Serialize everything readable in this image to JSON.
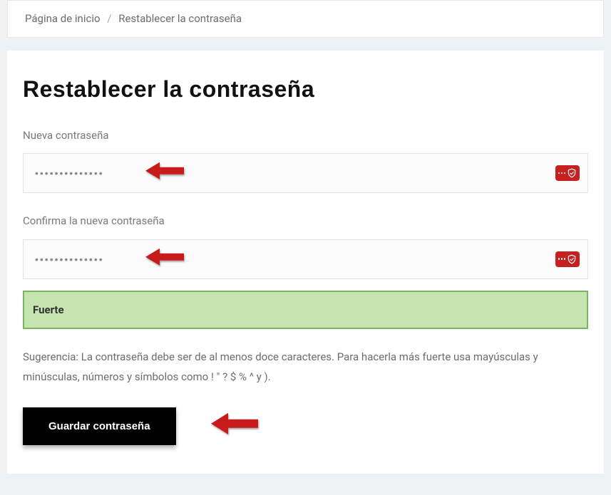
{
  "breadcrumb": {
    "home": "Página de inicio",
    "separator": "/",
    "current": "Restablecer la contraseña"
  },
  "page": {
    "title": "Restablecer la contraseña"
  },
  "form": {
    "new_password": {
      "label": "Nueva contraseña",
      "value": "••••••••••••••"
    },
    "confirm_password": {
      "label": "Confirma la nueva contraseña",
      "value": "••••••••••••••"
    },
    "strength": {
      "label": "Fuerte"
    },
    "hint": "Sugerencia: La contraseña debe ser de al menos doce caracteres. Para hacerla más fuerte usa mayúsculas y minúsculas, números y símbolos como ! \" ? $ % ^ y ).",
    "submit_label": "Guardar contraseña"
  },
  "icons": {
    "password_manager": "password-manager-icon",
    "arrow": "annotation-arrow-icon"
  },
  "colors": {
    "strength_bg": "#c5e4b0",
    "strength_border": "#79b562",
    "ext_icon_bg": "#c62121",
    "arrow": "#c81e1e",
    "submit_bg": "#000000"
  }
}
